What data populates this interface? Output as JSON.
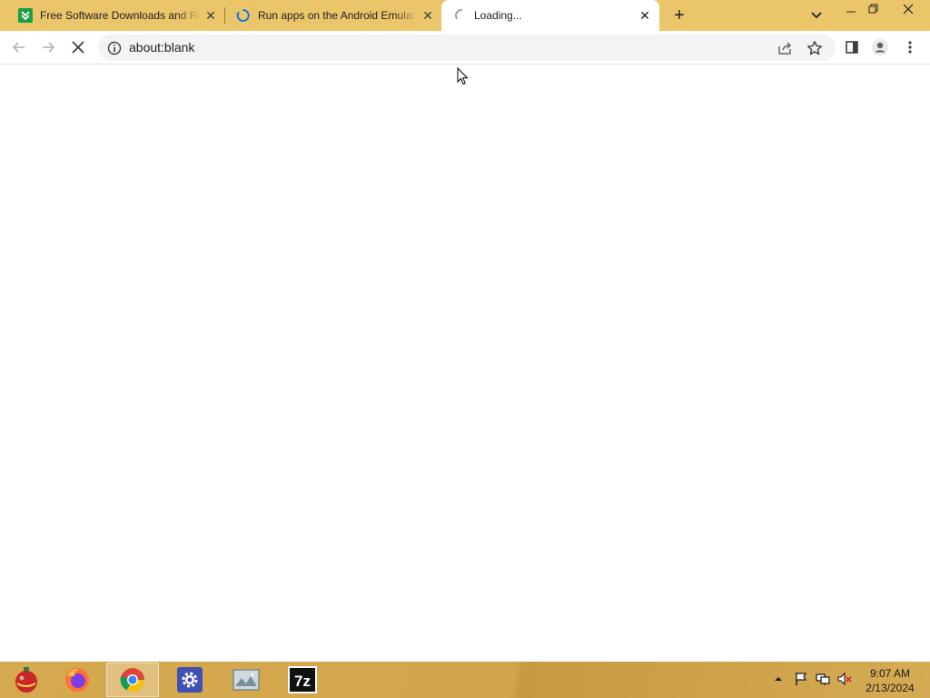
{
  "browser": {
    "tabs": [
      {
        "title": "Free Software Downloads and Re",
        "favicon": "softonic-icon",
        "close": "✕"
      },
      {
        "title": "Run apps on the Android Emulat",
        "favicon": "loading-spinner-icon",
        "close": "✕"
      },
      {
        "title": "Loading...",
        "favicon": "loading-spinner-icon",
        "close": "✕",
        "active": true
      }
    ],
    "new_tab": "+",
    "address_bar": {
      "url": "about:blank"
    },
    "colors": {
      "tab_strip": "#ebc569",
      "active_tab": "#ffffff",
      "omnibox": "#f1f3f4"
    }
  },
  "taskbar": {
    "apps": [
      {
        "name": "ornament-icon"
      },
      {
        "name": "firefox-icon"
      },
      {
        "name": "chrome-icon",
        "active": true
      },
      {
        "name": "settings-gear-icon"
      },
      {
        "name": "photo-viewer-icon"
      },
      {
        "name": "7zip-icon",
        "label": "7z"
      }
    ],
    "tray": [
      "show-hidden-icons-icon",
      "flag-icon",
      "network-icon",
      "volume-muted-icon"
    ],
    "clock": {
      "time": "9:07 AM",
      "date": "2/13/2024"
    }
  }
}
